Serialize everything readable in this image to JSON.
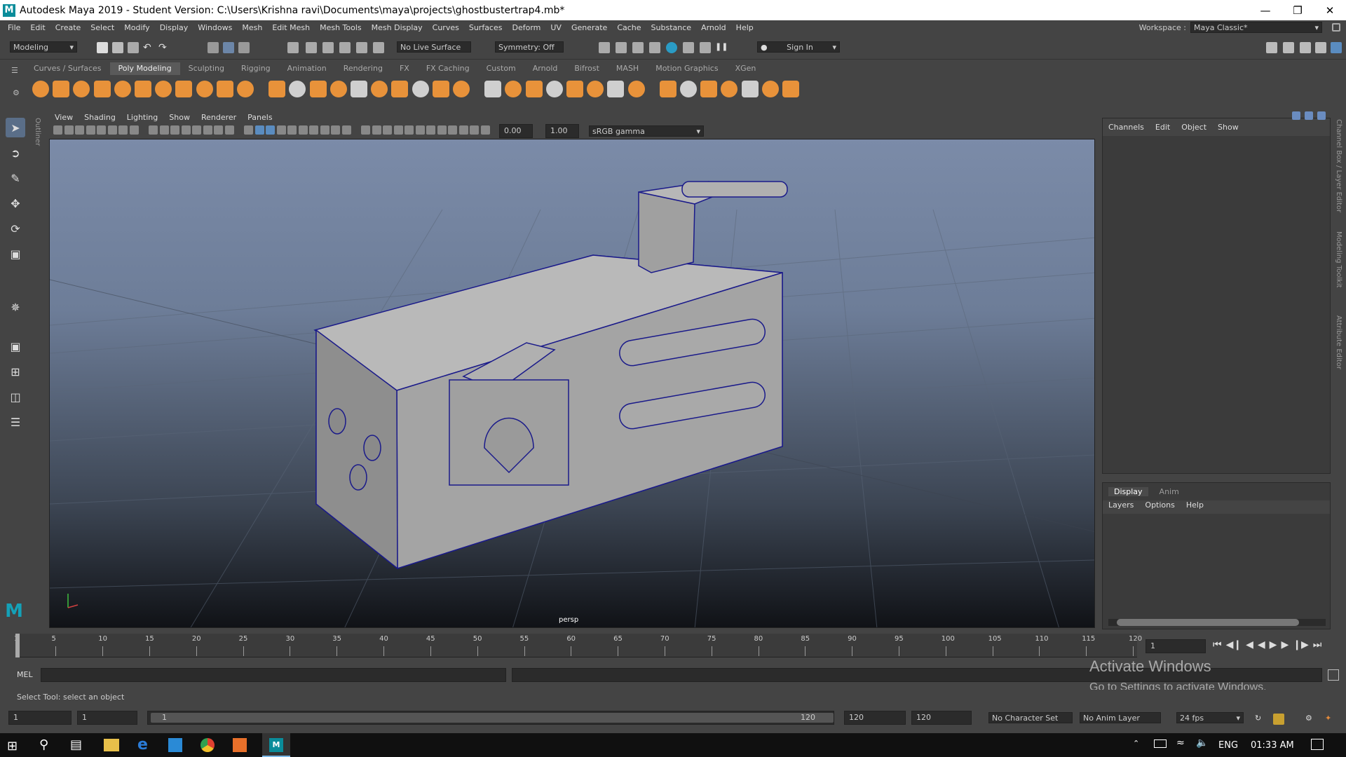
{
  "window": {
    "title": "Autodesk Maya 2019 - Student Version: C:\\Users\\Krishna ravi\\Documents\\maya\\projects\\ghostbustertrap4.mb*"
  },
  "menu": [
    "File",
    "Edit",
    "Create",
    "Select",
    "Modify",
    "Display",
    "Windows",
    "Mesh",
    "Edit Mesh",
    "Mesh Tools",
    "Mesh Display",
    "Curves",
    "Surfaces",
    "Deform",
    "UV",
    "Generate",
    "Cache",
    "Substance",
    "Arnold",
    "Help"
  ],
  "workspace": {
    "label": "Workspace :",
    "value": "Maya Classic*"
  },
  "statusline": {
    "mode": "Modeling",
    "live_surface": "No Live Surface",
    "symmetry": "Symmetry: Off",
    "sign_in": "Sign In"
  },
  "shelf_tabs": [
    "Curves / Surfaces",
    "Poly Modeling",
    "Sculpting",
    "Rigging",
    "Animation",
    "Rendering",
    "FX",
    "FX Caching",
    "Custom",
    "Arnold",
    "Bifrost",
    "MASH",
    "Motion Graphics",
    "XGen"
  ],
  "shelf_active": "Poly Modeling",
  "viewport": {
    "menu": [
      "View",
      "Shading",
      "Lighting",
      "Show",
      "Renderer",
      "Panels"
    ],
    "exposure": "0.00",
    "gamma": "1.00",
    "color_space": "sRGB gamma",
    "camera": "persp",
    "outliner_label": "Outliner"
  },
  "channel_box": {
    "tabs": [
      "Channels",
      "Edit",
      "Object",
      "Show"
    ],
    "side_label": "Channel Box / Layer Editor"
  },
  "side_labels": [
    "Modeling Toolkit",
    "Attribute Editor"
  ],
  "layer_editor": {
    "tabs": [
      "Display",
      "Anim"
    ],
    "menu": [
      "Layers",
      "Options",
      "Help"
    ]
  },
  "timeline": {
    "ticks": [
      "1",
      "5",
      "10",
      "15",
      "20",
      "25",
      "30",
      "35",
      "40",
      "45",
      "50",
      "55",
      "60",
      "65",
      "70",
      "75",
      "80",
      "85",
      "90",
      "95",
      "100",
      "105",
      "110",
      "115",
      "120"
    ],
    "current_frame": "1"
  },
  "mel": {
    "label": "MEL"
  },
  "help_line": "Select Tool: select an object",
  "range": {
    "start": "1",
    "anim_start": "1",
    "slider_start": "1",
    "slider_end": "120",
    "end": "120",
    "anim_end": "120",
    "character_set": "No Character Set",
    "anim_layer": "No Anim Layer",
    "fps": "24 fps"
  },
  "watermark": {
    "line1": "Activate Windows",
    "line2": "Go to Settings to activate Windows."
  },
  "taskbar": {
    "lang": "ENG",
    "time": "01:33 AM"
  }
}
